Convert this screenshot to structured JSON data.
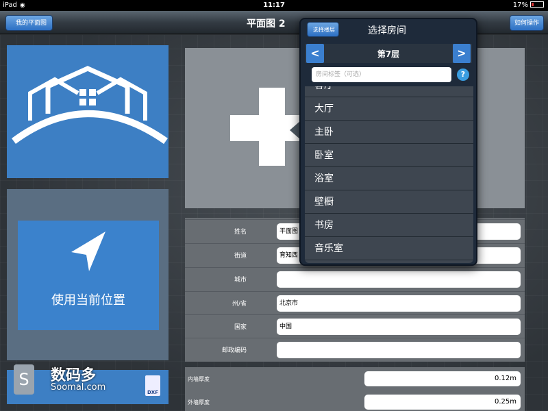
{
  "statusbar": {
    "device": "iPad",
    "time": "11:17",
    "battery": "17%"
  },
  "navbar": {
    "back_label": "我的平面图",
    "title": "平面图 2",
    "help_label": "如何操作"
  },
  "location": {
    "label": "使用当前位置"
  },
  "form": {
    "rows": [
      {
        "label": "姓名",
        "value": "平面图"
      },
      {
        "label": "街道",
        "value": "育知西"
      },
      {
        "label": "城市",
        "value": ""
      },
      {
        "label": "州/省",
        "value": "北京市"
      },
      {
        "label": "国家",
        "value": "中国"
      },
      {
        "label": "邮政编码",
        "value": ""
      }
    ]
  },
  "thickness": [
    {
      "label": "内墙厚度",
      "value": "0.12m"
    },
    {
      "label": "外墙厚度",
      "value": "0.25m"
    }
  ],
  "watermark": {
    "cn": "数码多",
    "en": "Soomal.com"
  },
  "export": {
    "dxf_label": "DXF"
  },
  "popover": {
    "back_label": "选择楼层",
    "title": "选择房间",
    "prev": "<",
    "next": ">",
    "floor": "第7层",
    "room_placeholder": "房间标签（可选）",
    "help": "?",
    "rooms": [
      "客厅",
      "大厅",
      "主卧",
      "卧室",
      "浴室",
      "壁橱",
      "书房",
      "音乐室"
    ]
  }
}
